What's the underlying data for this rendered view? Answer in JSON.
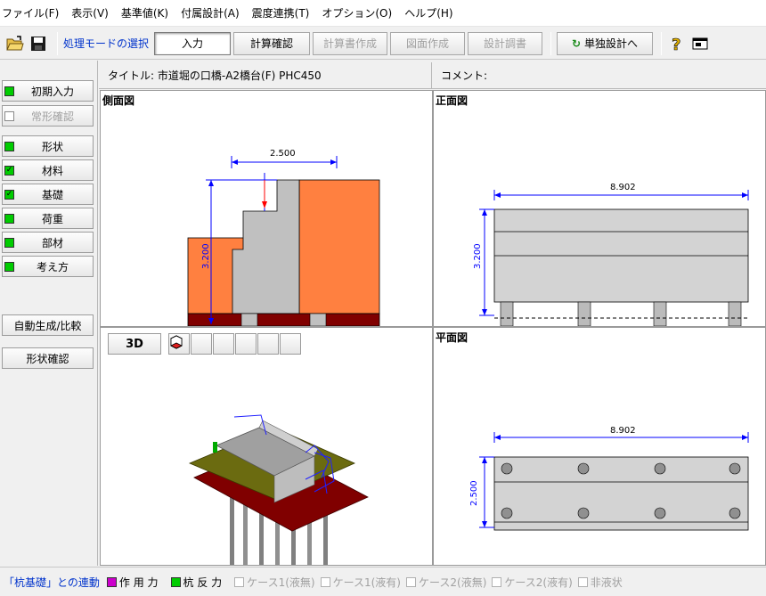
{
  "menu": {
    "items": [
      "ファイル(F)",
      "表示(V)",
      "基準値(K)",
      "付属設計(A)",
      "震度連携(T)",
      "オプション(O)",
      "ヘルプ(H)"
    ]
  },
  "toolbar": {
    "mode_label": "処理モードの選択",
    "buttons": {
      "input": "入力",
      "calc_check": "計算確認",
      "calc_report": "計算書作成",
      "drawing": "図面作成",
      "design_doc": "設計調書",
      "single_design": "単独設計へ"
    }
  },
  "sidebar": {
    "items": [
      {
        "label": "初期入力"
      },
      {
        "label": "常形確認"
      },
      {
        "label": "形状"
      },
      {
        "label": "材料"
      },
      {
        "label": "基礎"
      },
      {
        "label": "荷重"
      },
      {
        "label": "部材"
      },
      {
        "label": "考え方"
      }
    ],
    "auto_generate": "自動生成/比較",
    "shape_check": "形状確認"
  },
  "info": {
    "title": "タイトル: 市道堀の口橋-A2橋台(F) PHC450",
    "comment": "コメント:"
  },
  "panes": {
    "side_view": {
      "label": "側面図",
      "dim_width": "2.500",
      "dim_height": "3.200"
    },
    "front_view": {
      "label": "正面図",
      "dim_width": "8.902",
      "dim_height": "3.200"
    },
    "view3d": {
      "button": "3D"
    },
    "plan_view": {
      "label": "平面図",
      "dim_width": "8.902",
      "dim_height": "2.500"
    }
  },
  "status": {
    "link": "「杭基礎」との連動",
    "legend_action": "作 用 力",
    "legend_reaction": "杭 反 力",
    "cases": [
      "ケース1(液無)",
      "ケース1(液有)",
      "ケース2(液無)",
      "ケース2(液有)",
      "非液状"
    ]
  },
  "colors": {
    "action": "#cc00cc",
    "reaction": "#00cc00",
    "soil": "#ff8040",
    "footing": "#800000",
    "concrete": "#c0c0c0",
    "dimension": "#0000ff"
  }
}
